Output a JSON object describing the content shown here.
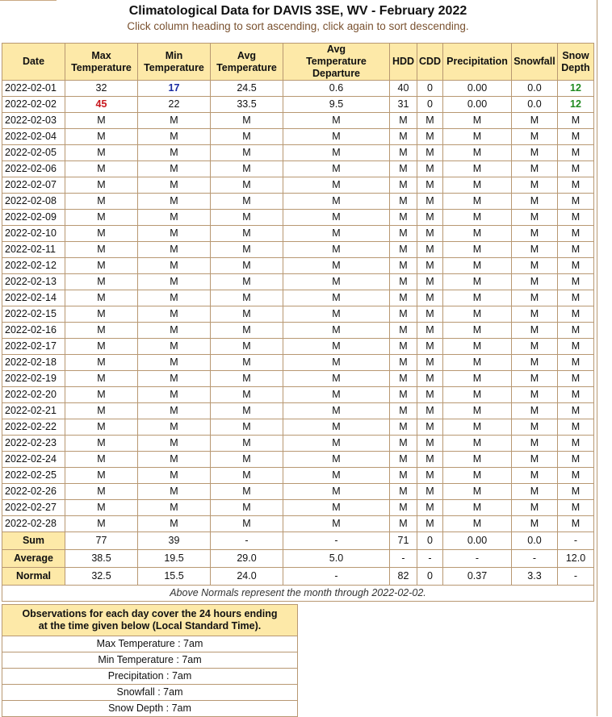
{
  "title": "Climatological Data for DAVIS 3SE, WV - February 2022",
  "subtitle": "Click column heading to sort ascending, click again to sort descending.",
  "columns": [
    {
      "key": "date",
      "label": "Date"
    },
    {
      "key": "max_temp",
      "label": "Max Temperature"
    },
    {
      "key": "min_temp",
      "label": "Min Temperature"
    },
    {
      "key": "avg_temp",
      "label": "Avg Temperature"
    },
    {
      "key": "avg_dep",
      "label": "Avg Temperature Departure"
    },
    {
      "key": "hdd",
      "label": "HDD"
    },
    {
      "key": "cdd",
      "label": "CDD"
    },
    {
      "key": "precip",
      "label": "Precipitation"
    },
    {
      "key": "snowfall",
      "label": "Snowfall"
    },
    {
      "key": "snow_depth",
      "label": "Snow Depth"
    }
  ],
  "highlight_colors": {
    "blue": "#1a2aa0",
    "red": "#c8161d",
    "green": "#1f8a1f"
  },
  "rows": [
    {
      "cells": [
        "2022-02-01",
        "32",
        "17",
        "24.5",
        "0.6",
        "40",
        "0",
        "0.00",
        "0.0",
        "12"
      ],
      "colors": [
        "",
        "",
        "blue",
        "",
        "",
        "",
        "",
        "",
        "",
        "green"
      ]
    },
    {
      "cells": [
        "2022-02-02",
        "45",
        "22",
        "33.5",
        "9.5",
        "31",
        "0",
        "0.00",
        "0.0",
        "12"
      ],
      "colors": [
        "",
        "red",
        "",
        "",
        "",
        "",
        "",
        "",
        "",
        "green"
      ]
    },
    {
      "cells": [
        "2022-02-03",
        "M",
        "M",
        "M",
        "M",
        "M",
        "M",
        "M",
        "M",
        "M"
      ]
    },
    {
      "cells": [
        "2022-02-04",
        "M",
        "M",
        "M",
        "M",
        "M",
        "M",
        "M",
        "M",
        "M"
      ]
    },
    {
      "cells": [
        "2022-02-05",
        "M",
        "M",
        "M",
        "M",
        "M",
        "M",
        "M",
        "M",
        "M"
      ]
    },
    {
      "cells": [
        "2022-02-06",
        "M",
        "M",
        "M",
        "M",
        "M",
        "M",
        "M",
        "M",
        "M"
      ]
    },
    {
      "cells": [
        "2022-02-07",
        "M",
        "M",
        "M",
        "M",
        "M",
        "M",
        "M",
        "M",
        "M"
      ]
    },
    {
      "cells": [
        "2022-02-08",
        "M",
        "M",
        "M",
        "M",
        "M",
        "M",
        "M",
        "M",
        "M"
      ]
    },
    {
      "cells": [
        "2022-02-09",
        "M",
        "M",
        "M",
        "M",
        "M",
        "M",
        "M",
        "M",
        "M"
      ]
    },
    {
      "cells": [
        "2022-02-10",
        "M",
        "M",
        "M",
        "M",
        "M",
        "M",
        "M",
        "M",
        "M"
      ]
    },
    {
      "cells": [
        "2022-02-11",
        "M",
        "M",
        "M",
        "M",
        "M",
        "M",
        "M",
        "M",
        "M"
      ]
    },
    {
      "cells": [
        "2022-02-12",
        "M",
        "M",
        "M",
        "M",
        "M",
        "M",
        "M",
        "M",
        "M"
      ]
    },
    {
      "cells": [
        "2022-02-13",
        "M",
        "M",
        "M",
        "M",
        "M",
        "M",
        "M",
        "M",
        "M"
      ]
    },
    {
      "cells": [
        "2022-02-14",
        "M",
        "M",
        "M",
        "M",
        "M",
        "M",
        "M",
        "M",
        "M"
      ]
    },
    {
      "cells": [
        "2022-02-15",
        "M",
        "M",
        "M",
        "M",
        "M",
        "M",
        "M",
        "M",
        "M"
      ]
    },
    {
      "cells": [
        "2022-02-16",
        "M",
        "M",
        "M",
        "M",
        "M",
        "M",
        "M",
        "M",
        "M"
      ]
    },
    {
      "cells": [
        "2022-02-17",
        "M",
        "M",
        "M",
        "M",
        "M",
        "M",
        "M",
        "M",
        "M"
      ]
    },
    {
      "cells": [
        "2022-02-18",
        "M",
        "M",
        "M",
        "M",
        "M",
        "M",
        "M",
        "M",
        "M"
      ]
    },
    {
      "cells": [
        "2022-02-19",
        "M",
        "M",
        "M",
        "M",
        "M",
        "M",
        "M",
        "M",
        "M"
      ]
    },
    {
      "cells": [
        "2022-02-20",
        "M",
        "M",
        "M",
        "M",
        "M",
        "M",
        "M",
        "M",
        "M"
      ]
    },
    {
      "cells": [
        "2022-02-21",
        "M",
        "M",
        "M",
        "M",
        "M",
        "M",
        "M",
        "M",
        "M"
      ]
    },
    {
      "cells": [
        "2022-02-22",
        "M",
        "M",
        "M",
        "M",
        "M",
        "M",
        "M",
        "M",
        "M"
      ]
    },
    {
      "cells": [
        "2022-02-23",
        "M",
        "M",
        "M",
        "M",
        "M",
        "M",
        "M",
        "M",
        "M"
      ]
    },
    {
      "cells": [
        "2022-02-24",
        "M",
        "M",
        "M",
        "M",
        "M",
        "M",
        "M",
        "M",
        "M"
      ]
    },
    {
      "cells": [
        "2022-02-25",
        "M",
        "M",
        "M",
        "M",
        "M",
        "M",
        "M",
        "M",
        "M"
      ]
    },
    {
      "cells": [
        "2022-02-26",
        "M",
        "M",
        "M",
        "M",
        "M",
        "M",
        "M",
        "M",
        "M"
      ]
    },
    {
      "cells": [
        "2022-02-27",
        "M",
        "M",
        "M",
        "M",
        "M",
        "M",
        "M",
        "M",
        "M"
      ]
    },
    {
      "cells": [
        "2022-02-28",
        "M",
        "M",
        "M",
        "M",
        "M",
        "M",
        "M",
        "M",
        "M"
      ]
    }
  ],
  "summary": [
    {
      "label": "Sum",
      "cells": [
        "77",
        "39",
        "-",
        "-",
        "71",
        "0",
        "0.00",
        "0.0",
        "-"
      ]
    },
    {
      "label": "Average",
      "cells": [
        "38.5",
        "19.5",
        "29.0",
        "5.0",
        "-",
        "-",
        "-",
        "-",
        "12.0"
      ]
    },
    {
      "label": "Normal",
      "cells": [
        "32.5",
        "15.5",
        "24.0",
        "-",
        "82",
        "0",
        "0.37",
        "3.3",
        "-"
      ]
    }
  ],
  "normals_note": "Above Normals represent the month through 2022-02-02.",
  "observations": {
    "heading": "Observations for each day cover the 24 hours ending at the time given below (Local Standard Time).",
    "items": [
      "Max Temperature : 7am",
      "Min Temperature : 7am",
      "Precipitation : 7am",
      "Snowfall : 7am",
      "Snow Depth : 7am"
    ]
  }
}
